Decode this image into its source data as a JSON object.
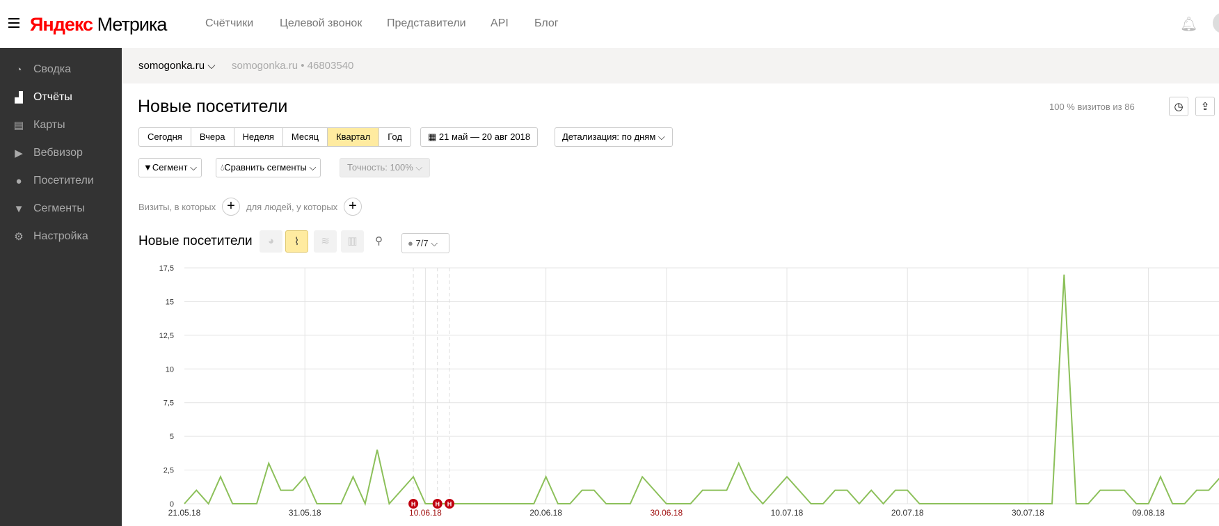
{
  "header": {
    "logo_yandex": "Яндекс",
    "logo_metrika": "Метрика",
    "nav": [
      "Счётчики",
      "Целевой звонок",
      "Представители",
      "API",
      "Блог"
    ]
  },
  "sidebar": {
    "items": [
      {
        "label": "Сводка",
        "icon": "gauge-icon"
      },
      {
        "label": "Отчёты",
        "icon": "bar-chart-icon",
        "active": true
      },
      {
        "label": "Карты",
        "icon": "map-icon"
      },
      {
        "label": "Вебвизор",
        "icon": "play-icon"
      },
      {
        "label": "Посетители",
        "icon": "user-icon"
      },
      {
        "label": "Сегменты",
        "icon": "filter-icon"
      },
      {
        "label": "Настройка",
        "icon": "gear-icon"
      }
    ]
  },
  "site": {
    "name": "somogonka.ru",
    "secondary": "somogonka.ru • 46803540"
  },
  "report": {
    "title": "Новые посетители",
    "visits_info": "100 % визитов из 86",
    "periods": [
      "Сегодня",
      "Вчера",
      "Неделя",
      "Месяц",
      "Квартал",
      "Год"
    ],
    "selected_period": "Квартал",
    "date_range": "21 май — 20 авг 2018",
    "detail": "Детализация: по дням",
    "segment": "Сегмент",
    "compare": "Сравнить сегменты",
    "accuracy": "Точность: 100%",
    "cond_visits": "Визиты, в которых",
    "cond_people": "для людей, у которых",
    "chart_title": "Новые посетители",
    "annotations_filter": "7/7"
  },
  "colors": {
    "line": "#8cc05a",
    "accent": "#ffeba0",
    "sidebar": "#333333",
    "annotation": "#c0000f",
    "weekend": "#a01010"
  },
  "chart_data": {
    "type": "line",
    "title": "Новые посетители",
    "x_start": "21.05.18",
    "x_tick_labels": [
      "21.05.18",
      "31.05.18",
      "10.06.18",
      "20.06.18",
      "30.06.18",
      "10.07.18",
      "20.07.18",
      "30.07.18",
      "09.08.18"
    ],
    "x_tick_weekend": [
      false,
      false,
      true,
      false,
      true,
      false,
      false,
      false,
      false
    ],
    "y_tick_labels": [
      "0",
      "2,5",
      "5",
      "7,5",
      "10",
      "12,5",
      "15",
      "17,5"
    ],
    "ylim": [
      0,
      17.5
    ],
    "grid": true,
    "annotations": [
      {
        "date": "09.06.18",
        "label": "Н"
      },
      {
        "date": "11.06.18",
        "label": "Н"
      },
      {
        "date": "12.06.18",
        "label": "Н"
      }
    ],
    "values": [
      0,
      1,
      0,
      2,
      0,
      0,
      0,
      3,
      1,
      1,
      2,
      0,
      0,
      0,
      2,
      0,
      4,
      0,
      1,
      2,
      0,
      0,
      0,
      0,
      0,
      0,
      0,
      0,
      0,
      0,
      2,
      0,
      0,
      1,
      1,
      0,
      0,
      0,
      2,
      1,
      0,
      0,
      0,
      1,
      1,
      1,
      3,
      1,
      0,
      1,
      2,
      1,
      0,
      0,
      1,
      1,
      0,
      1,
      0,
      1,
      1,
      0,
      0,
      0,
      0,
      0,
      0,
      0,
      0,
      0,
      0,
      0,
      0,
      17,
      0,
      0,
      1,
      1,
      1,
      0,
      0,
      2,
      0,
      0,
      1,
      1,
      2
    ]
  }
}
